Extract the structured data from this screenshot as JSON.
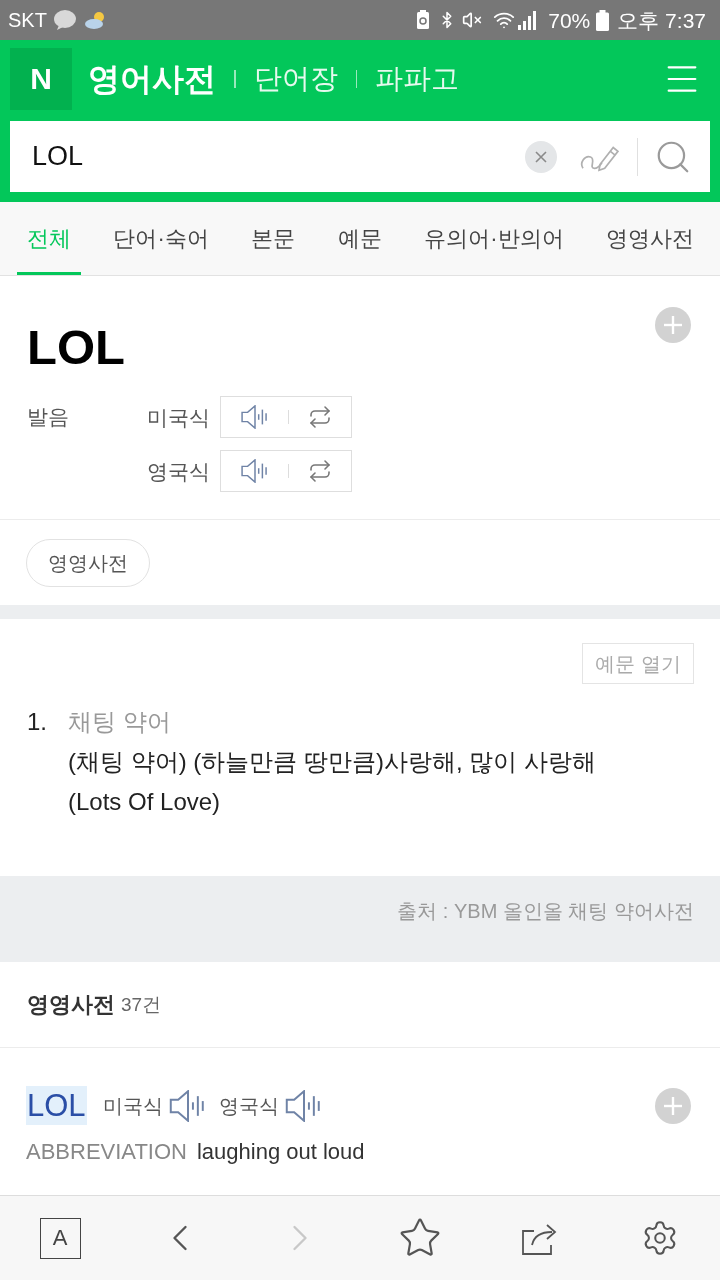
{
  "status_bar": {
    "carrier": "SKT",
    "battery": "70%",
    "time": "오후 7:37"
  },
  "header": {
    "logo": "N",
    "nav": [
      {
        "label": "영어사전",
        "selected": true
      },
      {
        "label": "단어장",
        "selected": false
      },
      {
        "label": "파파고",
        "selected": false
      }
    ]
  },
  "search": {
    "value": "LOL"
  },
  "tabs": [
    {
      "label": "전체",
      "selected": true
    },
    {
      "label": "단어·숙어",
      "selected": false
    },
    {
      "label": "본문",
      "selected": false
    },
    {
      "label": "예문",
      "selected": false
    },
    {
      "label": "유의어·반의어",
      "selected": false
    },
    {
      "label": "영영사전",
      "selected": false
    }
  ],
  "entry": {
    "word": "LOL",
    "pronunciation_label": "발음",
    "pronunciations": [
      {
        "label": "미국식"
      },
      {
        "label": "영국식"
      }
    ],
    "dictionary_chip": "영영사전"
  },
  "meanings": {
    "examples_button": "예문 열기",
    "items": [
      {
        "number": "1.",
        "category": "채팅 약어",
        "definition": "(채팅 약어) (하늘만큼 땅만큼)사랑해, 많이 사랑해 (Lots Of Love)"
      }
    ],
    "source": "출처 : YBM 올인올 채팅 약어사전"
  },
  "english_dictionary": {
    "title": "영영사전",
    "count": "37건",
    "entries": [
      {
        "word": "LOL",
        "highlighted": true,
        "accents": [
          {
            "label": "미국식"
          },
          {
            "label": "영국식"
          }
        ],
        "part_of_speech": "ABBREVIATION",
        "definition": "laughing out loud"
      }
    ]
  },
  "toolbar": [
    {
      "kind": "text_size",
      "label": "A",
      "disabled": false
    },
    {
      "kind": "back",
      "disabled": false
    },
    {
      "kind": "forward",
      "disabled": true
    },
    {
      "kind": "bookmark",
      "disabled": false
    },
    {
      "kind": "share",
      "disabled": false
    },
    {
      "kind": "settings",
      "disabled": false
    }
  ]
}
